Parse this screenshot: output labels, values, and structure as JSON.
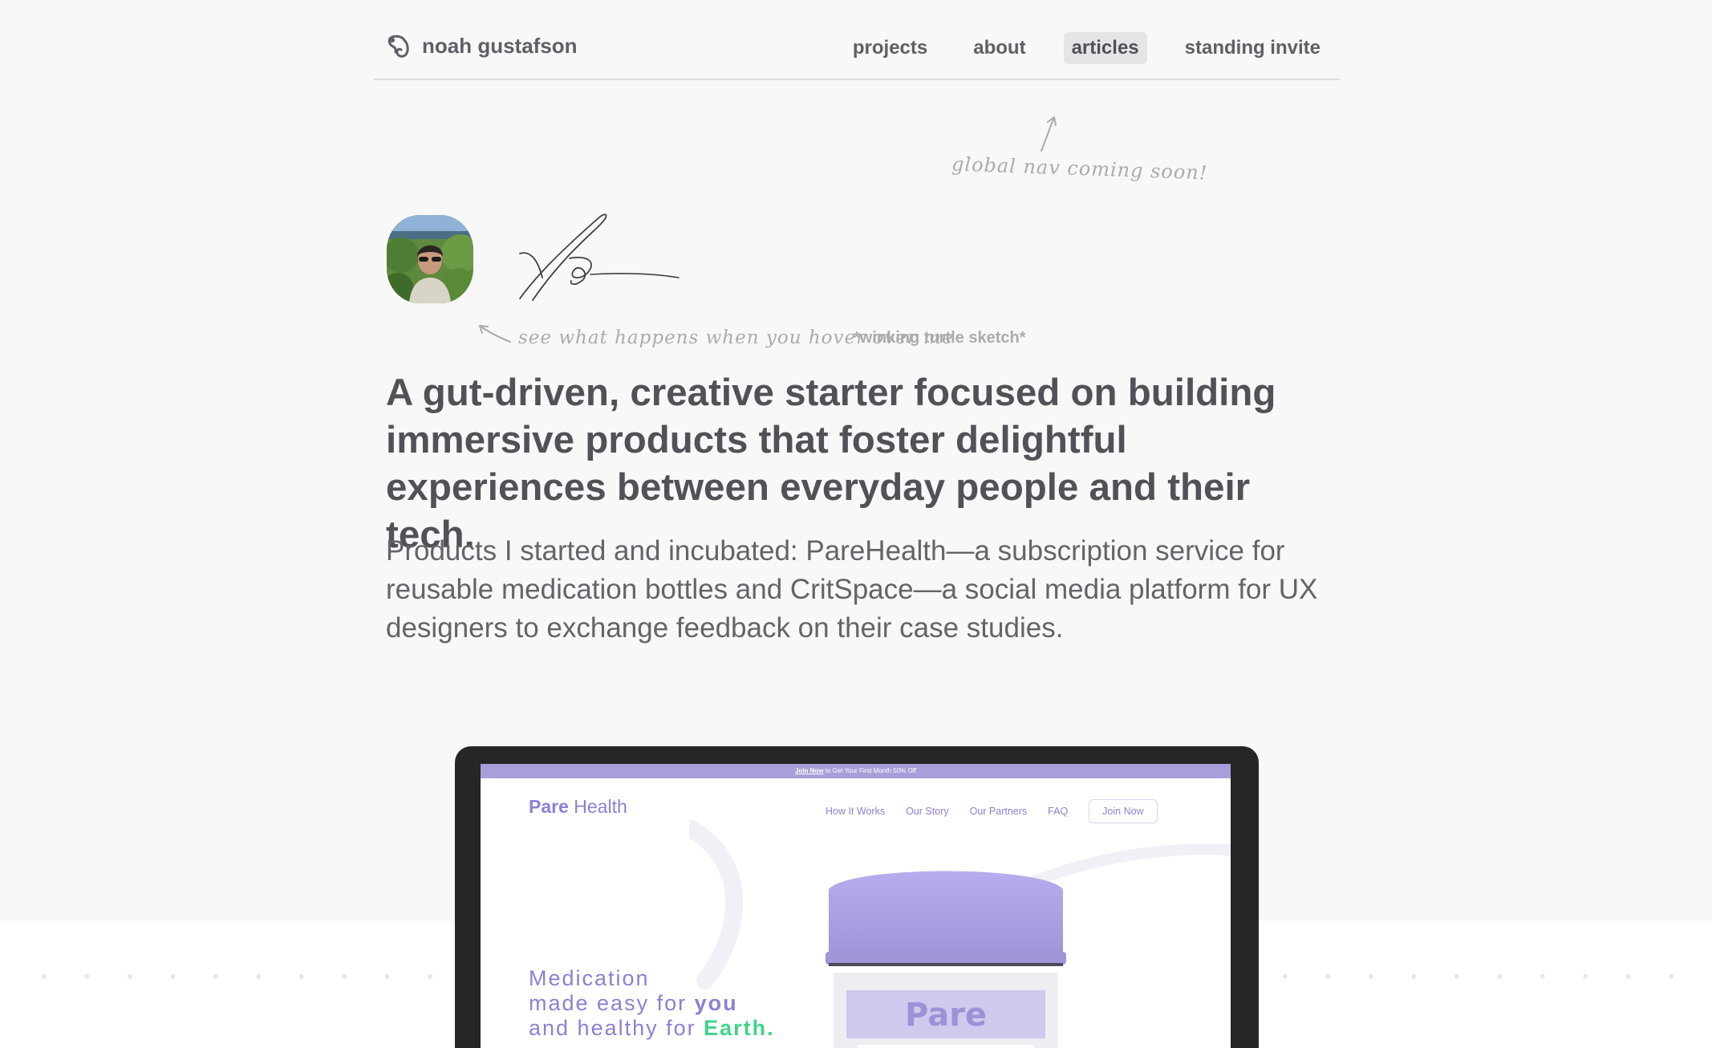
{
  "header": {
    "site_name": "noah gustafson",
    "nav": [
      "projects",
      "about",
      "articles",
      "standing invite"
    ],
    "active_nav": "articles"
  },
  "notes": {
    "global_nav": "global nav coming soon!",
    "hover_hint": "see what happens when you hover over me",
    "hover_bold": "*winking turtle sketch*"
  },
  "hero": {
    "headline": "A gut-driven, creative starter focused on building immersive products that foster delightful experiences between everyday people and their tech.",
    "subtext": "Products I started and incubated: PareHealth—a subscription service for reusable medication bottles and CritSpace—a social media platform for UX designers to exchange feedback on their case studies."
  },
  "laptop_screen": {
    "promo_link": "Join Now",
    "promo_text": " to Get Your First Month 50% Off",
    "logo_bold": "Pare",
    "logo_rest": " Health",
    "nav": [
      "How It Works",
      "Our Story",
      "Our Partners",
      "FAQ"
    ],
    "join_button": "Join Now",
    "tagline_line1": "Medication",
    "tagline_line2_pre": "made easy for ",
    "tagline_line2_em": "you",
    "tagline_line3_pre": "and healthy for ",
    "tagline_line3_em": "Earth.",
    "bottle_label": "Pare",
    "accent_color": "#8d80d2",
    "green_color": "#3fd48c"
  }
}
